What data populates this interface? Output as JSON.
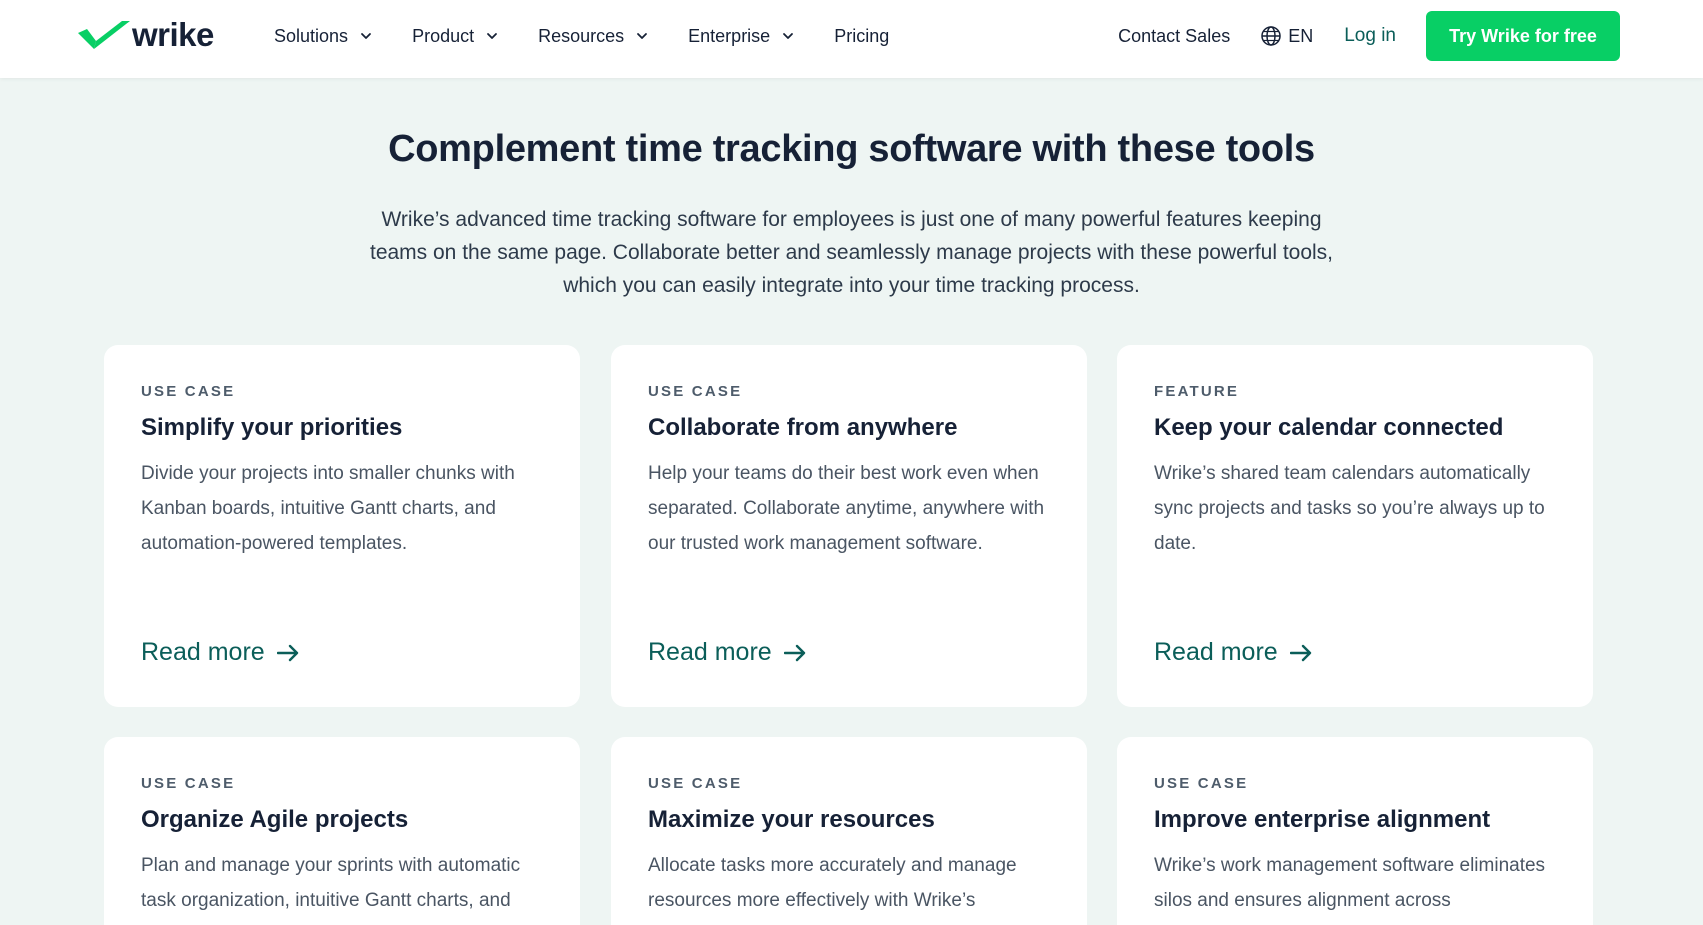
{
  "brand": {
    "name": "wrike",
    "color": "#08cf65"
  },
  "nav": {
    "menu": [
      {
        "label": "Solutions",
        "dropdown": true
      },
      {
        "label": "Product",
        "dropdown": true
      },
      {
        "label": "Resources",
        "dropdown": true
      },
      {
        "label": "Enterprise",
        "dropdown": true
      },
      {
        "label": "Pricing",
        "dropdown": false
      }
    ],
    "contact_sales": "Contact Sales",
    "language": "EN",
    "login": "Log in",
    "cta": "Try Wrike for free"
  },
  "section": {
    "title": "Complement time tracking software with these tools",
    "intro": "Wrike’s advanced time tracking software for employees is just one of many powerful features keeping teams on the same page. Collaborate better and seamlessly manage projects with these powerful tools, which you can easily integrate into your time tracking process."
  },
  "cards": [
    {
      "eyebrow": "USE CASE",
      "title": "Simplify your priorities",
      "description": "Divide your projects into smaller chunks with Kanban boards, intuitive Gantt charts, and automation-powered templates.",
      "link": "Read more"
    },
    {
      "eyebrow": "USE CASE",
      "title": "Collaborate from anywhere",
      "description": "Help your teams do their best work even when separated. Collaborate anytime, anywhere with our trusted work management software.",
      "link": "Read more"
    },
    {
      "eyebrow": "FEATURE",
      "title": "Keep your calendar connected",
      "description": "Wrike’s shared team calendars automatically sync projects and tasks so you’re always up to date.",
      "link": "Read more"
    },
    {
      "eyebrow": "USE CASE",
      "title": "Organize Agile projects",
      "description": "Plan and manage your sprints with automatic task organization, intuitive Gantt charts, and",
      "link": ""
    },
    {
      "eyebrow": "USE CASE",
      "title": "Maximize your resources",
      "description": "Allocate tasks more accurately and manage resources more effectively with Wrike’s",
      "link": ""
    },
    {
      "eyebrow": "USE CASE",
      "title": "Improve enterprise alignment",
      "description": "Wrike’s work management software eliminates silos and ensures alignment across",
      "link": ""
    }
  ]
}
